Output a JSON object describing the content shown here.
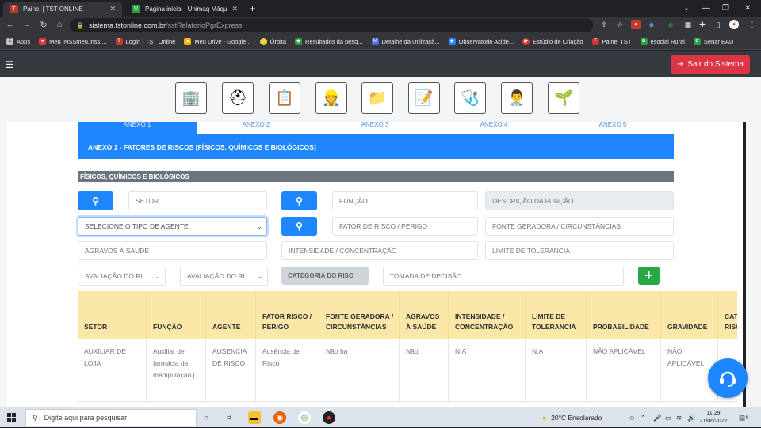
{
  "browser": {
    "tabs": [
      {
        "title": "Painel | TST ONLINE",
        "active": true
      },
      {
        "title": "Página inicial | Unimaq Máquinas",
        "active": false
      }
    ],
    "url_host": "sistema.tstonline.com.br",
    "url_path": "/sstRelatorioPgrExpress",
    "bookmarks": [
      "Apps",
      "Meu INSSmeu.inss....",
      "Login - TST Online",
      "Meu Drive - Google...",
      "Órbita",
      "Resultados da pesq...",
      "Detalhe da Utilizaçã...",
      "Observatorio Acide...",
      "Estúdio de Criação",
      "Painel TST",
      "esocial Rural",
      "Senar EAD"
    ]
  },
  "header": {
    "logout_label": "Sair do Sistema"
  },
  "icon_toolbar": [
    "buildings-icon",
    "hard-hat-icon",
    "medical-report-icon",
    "worker-icon",
    "health-folder-icon",
    "clipboard-medical-icon",
    "medical-clipboard-icon",
    "doctor-icon",
    "hands-plant-icon"
  ],
  "annex_tabs": [
    "ANEXO 1",
    "ANEXO 2",
    "ANEXO 3",
    "ANEXO 4",
    "ANEXO 5"
  ],
  "banner_title": "ANEXO 1 - FATORES DE RISCOS [FÍSICOS, QUÍMICOS E BIOLÓGICOS]",
  "section_title": "FÍSICOS, QUÍMICOS E BIOLÓGICOS",
  "form": {
    "setor_placeholder": "SETOR",
    "funcao_placeholder": "FUNÇÃO",
    "descricao_funcao_placeholder": "DESCRIÇÃO DA FUNÇÃO",
    "tipo_agente_value": "SELECIONE O TIPO DE AGENTE",
    "fator_risco_placeholder": "FATOR DE RISCO / PERIGO",
    "fonte_geradora_placeholder": "FONTE GERADORA / CIRCUNSTÂNCIAS",
    "agravos_placeholder": "AGRAVOS À SAÚDE",
    "intensidade_placeholder": "INTENSIDADE / CONCENTRAÇÃO",
    "limite_placeholder": "LIMITE DE TOLERÂNCIA",
    "avaliacao_1_value": "AVALIAÇÃO DO RI",
    "avaliacao_2_value": "AVALIAÇÃO DO RI",
    "categoria_label": "CATEGORIA DO RISC",
    "tomada_placeholder": "TOMADA DE DECISÃO",
    "add_label": "+"
  },
  "table": {
    "headers": [
      "SETOR",
      "FUNÇÃO",
      "AGENTE",
      "FATOR RISCO / PERIGO",
      "FONTE GERADORA / CIRCUNSTÂNCIAS",
      "AGRAVOS À SAÚDE",
      "INTENSIDADE / CONCENTRAÇÃO",
      "LIMITE DE TOLERANCIA",
      "PROBABILIDADE",
      "GRAVIDADE",
      "CATE RISCO"
    ],
    "rows": [
      [
        "AUXILIAR DE LOJA",
        "Auxiliar de farmácia de manipulação |",
        "AUSENCIA DE RISCO",
        "Ausência de Risco",
        "Não há",
        "Não",
        "N.A",
        "N.A",
        "NÃO APLICÁVEL",
        "NÃO APLICÁVEL",
        ""
      ]
    ]
  },
  "taskbar": {
    "search_placeholder": "Digite aqui para pesquisar",
    "weather": "20°C  Ensolarado",
    "time": "11:29",
    "date": "21/06/2022",
    "notif_count": "6"
  },
  "colors": {
    "primary": "#1e86ff",
    "danger": "#dc3545",
    "success": "#28a745",
    "table_header": "#fbe7a7"
  }
}
